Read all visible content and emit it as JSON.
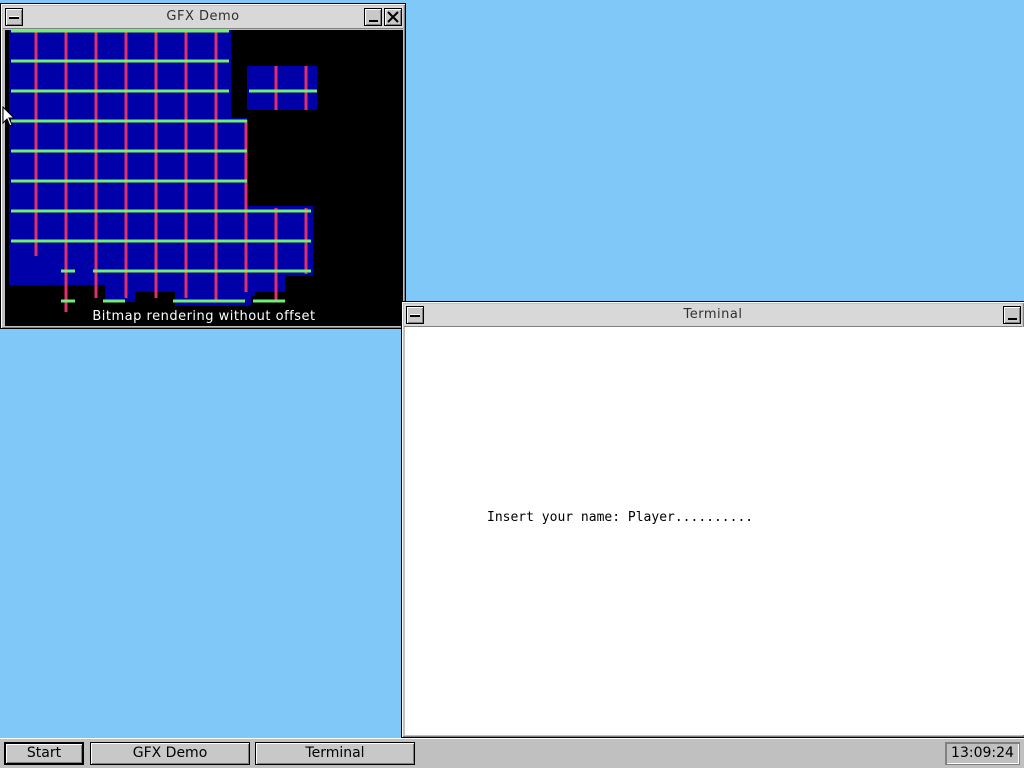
{
  "gfx_window": {
    "title": "GFX Demo",
    "caption": "Bitmap rendering without offset"
  },
  "terminal_window": {
    "title": "Terminal",
    "prompt_label": "Insert your name: ",
    "prompt_value": "Player.........."
  },
  "taskbar": {
    "start_label": "Start",
    "tasks": [
      "GFX Demo",
      "Terminal"
    ],
    "clock": "13:09:24"
  },
  "icons": {
    "system_menu": "system-menu-icon",
    "minimize": "minimize-icon",
    "close": "close-icon",
    "cursor": "mouse-pointer-icon"
  },
  "colors": {
    "desktop": "#80c8f8",
    "window_face": "#c0c0c0",
    "bitmap_blue": "#0000a8",
    "line_red": "#e0306a",
    "line_green": "#70f070"
  }
}
